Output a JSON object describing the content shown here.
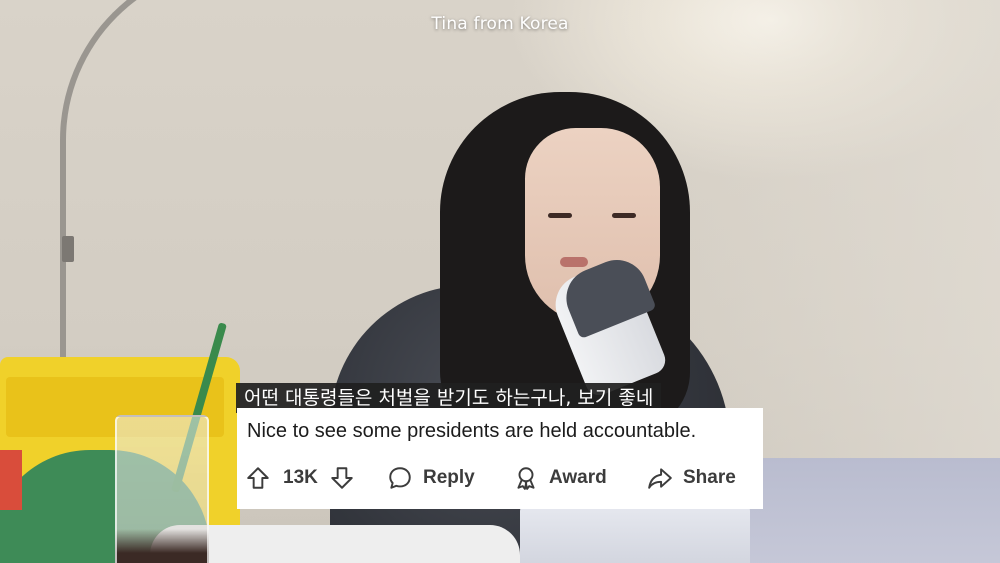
{
  "video": {
    "channel_title": "Tina from Korea"
  },
  "subtitle": {
    "korean": "어떤 대통령들은 처벌을 받기도 하는구나, 보기 좋네"
  },
  "comment": {
    "text": "Nice to see some presidents are held accountable.",
    "score": "13K",
    "actions": {
      "upvote_icon": "arrow-up-outline-icon",
      "downvote_icon": "arrow-down-outline-icon",
      "reply_label": "Reply",
      "reply_icon": "speech-bubble-icon",
      "award_label": "Award",
      "award_icon": "ribbon-award-icon",
      "share_label": "Share",
      "share_icon": "share-arrow-icon"
    }
  },
  "colors": {
    "card_background": "#ffffff",
    "text": "#1c1c1c",
    "action_text": "#3c3c3c",
    "subtitle_background": "#202020"
  }
}
